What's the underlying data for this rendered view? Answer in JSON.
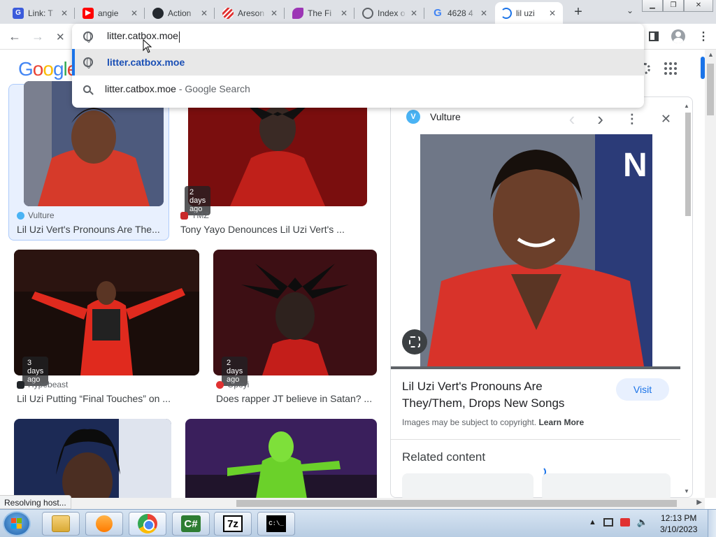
{
  "tabs": [
    {
      "title": "Link: T",
      "favicon": "generic-site-icon",
      "color": "#3b5bdb"
    },
    {
      "title": "angie",
      "favicon": "youtube-icon",
      "color": "#ff0000"
    },
    {
      "title": "Action",
      "favicon": "github-icon",
      "color": "#24292f"
    },
    {
      "title": "Areson",
      "favicon": "stripes-icon",
      "color": "#e03131"
    },
    {
      "title": "The Fi",
      "favicon": "purple-bird-icon",
      "color": "#9c36b5"
    },
    {
      "title": "Index o",
      "favicon": "globe-icon",
      "color": "#5f6368"
    },
    {
      "title": "4628 4",
      "favicon": "google-icon",
      "color": "#4285f4"
    },
    {
      "title": "lil uzi",
      "favicon": "loading-spinner-icon",
      "color": "#1a73e8"
    }
  ],
  "tab_close": "✕",
  "new_tab": "+",
  "tab_search": "⌄",
  "window_buttons": {
    "minimize": "▁",
    "restore": "❐",
    "close": "✕"
  },
  "toolbar": {
    "back": "←",
    "forward": "→",
    "stop": "✕",
    "omnibox_value": "litter.catbox.moe",
    "suggestions": [
      {
        "icon": "globe-icon",
        "text": "litter.catbox.moe",
        "sub": ""
      },
      {
        "icon": "search-icon",
        "text": "litter.catbox.moe",
        "sub": " - Google Search"
      }
    ],
    "kebab": "⋮"
  },
  "page": {
    "logo_letters": [
      "G",
      "o",
      "o",
      "g",
      "l",
      "e"
    ],
    "results": [
      {
        "source": "Vulture",
        "caption": "Lil Uzi Vert's Pronouns Are The...",
        "badge": "",
        "src_color": "#4ab3f4"
      },
      {
        "source": "TMZ",
        "caption": "Tony Yayo Denounces Lil Uzi Vert's ...",
        "badge": "2 days ago",
        "src_color": "#c92a2a"
      },
      {
        "source": "Hypebeast",
        "caption": "Lil Uzi Putting “Final Touches” on ...",
        "badge": "3 days ago",
        "src_color": "#212529"
      },
      {
        "source": "Opoyi",
        "caption": "Does rapper JT believe in Satan? ...",
        "badge": "2 days ago",
        "src_color": "#e03131"
      }
    ]
  },
  "panel": {
    "source": "Vulture",
    "source_badge": "V",
    "prev": "‹",
    "next": "›",
    "more": "⋮",
    "close": "✕",
    "title": "Lil Uzi Vert's Pronouns Are They/Them, Drops New Songs",
    "visit": "Visit",
    "copyright": "Images may be subject to copyright.",
    "learn_more": "Learn More",
    "related": "Related content"
  },
  "status_text": "Resolving host...",
  "taskbar": {
    "apps": [
      {
        "name": "explorer",
        "label": ""
      },
      {
        "name": "media-player",
        "label": ""
      },
      {
        "name": "chrome",
        "label": ""
      },
      {
        "name": "csharp",
        "label": "C#"
      },
      {
        "name": "7zip",
        "label": "7z"
      },
      {
        "name": "cmd",
        "label": "C:\\_"
      }
    ],
    "tray_arrow": "▲",
    "time": "12:13 PM",
    "date": "3/10/2023"
  }
}
